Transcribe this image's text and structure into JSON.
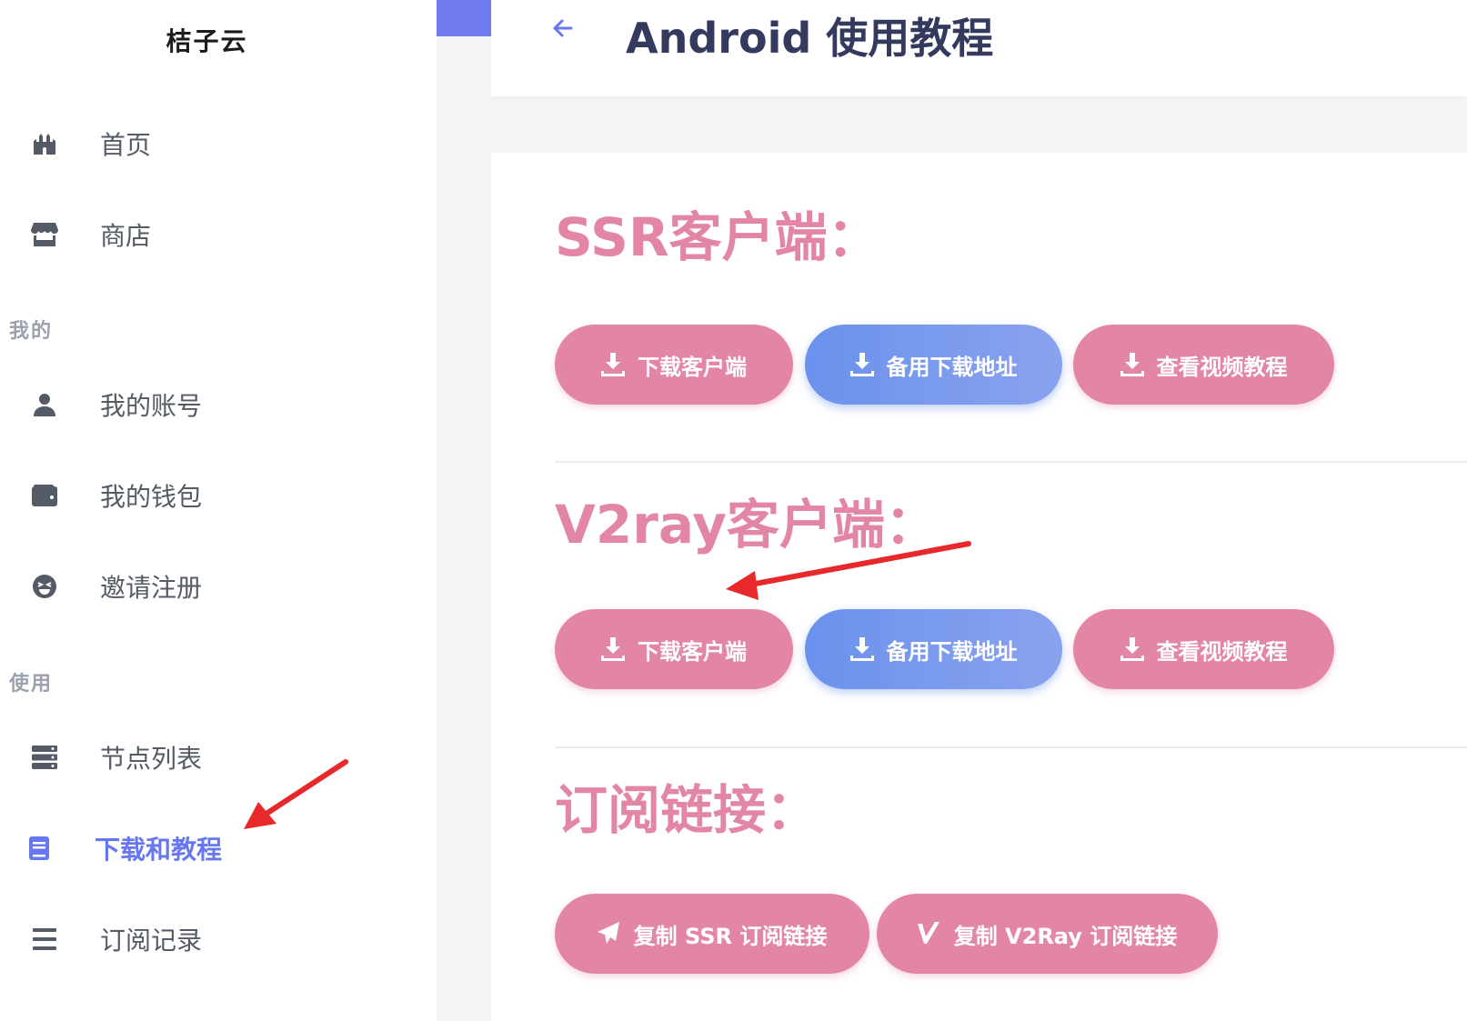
{
  "brand": "桔子云",
  "page_title": "Android 使用教程",
  "sidebar": {
    "items": [
      {
        "label": "首页",
        "icon": "castle-icon"
      },
      {
        "label": "商店",
        "icon": "store-icon"
      },
      {
        "label": "我的账号",
        "icon": "user-icon"
      },
      {
        "label": "我的钱包",
        "icon": "wallet-icon"
      },
      {
        "label": "邀请注册",
        "icon": "laugh-icon"
      },
      {
        "label": "节点列表",
        "icon": "server-icon"
      },
      {
        "label": "下载和教程",
        "icon": "book-icon",
        "active": true
      },
      {
        "label": "订阅记录",
        "icon": "list-icon"
      }
    ],
    "sections": [
      "我的",
      "使用"
    ]
  },
  "ssr": {
    "title": "SSR客户端：",
    "download": "下载客户端",
    "backup": "备用下载地址",
    "video": "查看视频教程"
  },
  "v2ray": {
    "title": "V2ray客户端：",
    "download": "下载客户端",
    "backup": "备用下载地址",
    "video": "查看视频教程"
  },
  "subscribe": {
    "title": "订阅链接：",
    "copy_ssr": "复制 SSR 订阅链接",
    "copy_v2ray": "复制 V2Ray 订阅链接"
  },
  "colors": {
    "accent": "#6777ef",
    "pink": "#e386a4",
    "blue": "#6a92ec",
    "annotation": "#e8282b"
  }
}
